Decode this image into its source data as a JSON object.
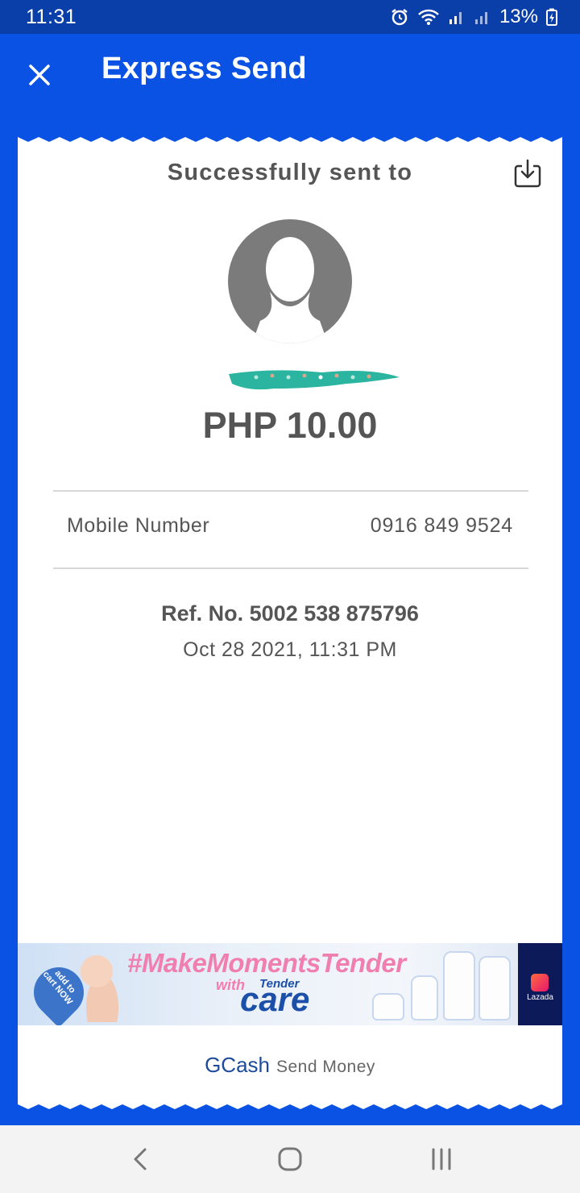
{
  "status_bar": {
    "time": "11:31",
    "battery": "13%",
    "icons": [
      "alarm-icon",
      "wifi-icon",
      "signal-icon",
      "signal-icon",
      "battery-charging-icon"
    ]
  },
  "header": {
    "title": "Express Send",
    "close_icon": "close-icon"
  },
  "receipt": {
    "heading": "Successfully sent to",
    "download_icon": "download-icon",
    "amount": "PHP 10.00",
    "details": [
      {
        "label": "Mobile Number",
        "value": "0916 849 9524"
      }
    ],
    "reference": "Ref. No. 5002 538 875796",
    "datetime": "Oct 28 2021, 11:31 PM"
  },
  "ad": {
    "hashtag": "#MakeMomentsTender",
    "with": "with",
    "brand_top": "Tender",
    "brand": "care",
    "badge": "add to cart NOW",
    "partner": "Lazada"
  },
  "footer": {
    "brand": "GCash",
    "tagline": "Send Money"
  },
  "colors": {
    "primary": "#0a52e4",
    "status_bar": "#0a3ea8",
    "text": "#555555",
    "redaction": "#2bb5a0"
  }
}
